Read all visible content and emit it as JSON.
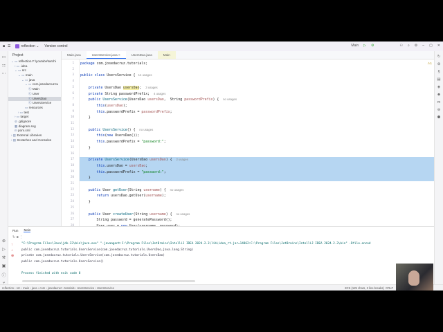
{
  "titlebar": {
    "project": "reflection",
    "vcs": "Version control",
    "run_config": "Main",
    "window_controls": [
      "–",
      "▢",
      "✕"
    ]
  },
  "project_panel": {
    "title": "Project",
    "tree": [
      {
        "label": "reflection  F:\\youtube\\tarchi",
        "d": 0,
        "ic": "⌄ ▭"
      },
      {
        "label": ".idea",
        "d": 1,
        "ic": "› ▭"
      },
      {
        "label": "src",
        "d": 1,
        "ic": "⌄ ▭"
      },
      {
        "label": "main",
        "d": 2,
        "ic": "⌄ ▭"
      },
      {
        "label": "java",
        "d": 3,
        "ic": "⌄ ▭"
      },
      {
        "label": "com.josedacruz.tu",
        "d": 4,
        "ic": "⌄ ▭"
      },
      {
        "label": "Main",
        "d": 5,
        "ic": "Ⓒ"
      },
      {
        "label": "User",
        "d": 5,
        "ic": "Ⓒ"
      },
      {
        "label": "UsersDao",
        "d": 5,
        "ic": "Ⓒ",
        "sel": true
      },
      {
        "label": "UsersService",
        "d": 5,
        "ic": "Ⓒ"
      },
      {
        "label": "resources",
        "d": 4,
        "ic": "▭"
      },
      {
        "label": "test",
        "d": 2,
        "ic": "› ▭"
      },
      {
        "label": "target",
        "d": 1,
        "ic": "› ▭"
      },
      {
        "label": ".gitignore",
        "d": 1,
        "ic": "⊘"
      },
      {
        "label": "diagram.svg",
        "d": 1,
        "ic": "▦"
      },
      {
        "label": "pom.xml",
        "d": 1,
        "ic": "m"
      },
      {
        "label": "External Libraries",
        "d": 0,
        "ic": "› ▥"
      },
      {
        "label": "Scratches and Consoles",
        "d": 0,
        "ic": "› ▤"
      }
    ]
  },
  "tabs": [
    {
      "label": "Main.java"
    },
    {
      "label": "UsersService.java ×",
      "active": true
    },
    {
      "label": "UsersDao.java"
    },
    {
      "label": "Main",
      "main": true
    }
  ],
  "editor": {
    "warnings": "⚠1",
    "lines": [
      [
        [
          "kw",
          "package "
        ],
        [
          "def",
          "com.josedacruz.tutorials;"
        ]
      ],
      [],
      [
        [
          "kw",
          "public class "
        ],
        [
          "def",
          "UsersService { "
        ],
        [
          "hint",
          " 14 usages"
        ]
      ],
      [],
      [
        [
          "kw",
          "    private "
        ],
        [
          "def",
          "UsersDao "
        ],
        [
          "occ",
          "usersDao"
        ],
        [
          "def",
          ";  "
        ],
        [
          "hint",
          "3 usages"
        ]
      ],
      [
        [
          "kw",
          "    private "
        ],
        [
          "def",
          "String passwordPrefix;  "
        ],
        [
          "hint",
          "4 usages"
        ]
      ],
      [
        [
          "kw",
          "    public "
        ],
        [
          "fn",
          "UsersService"
        ],
        [
          "def",
          "(UsersDao "
        ],
        [
          "par",
          "usersDao"
        ],
        [
          "def",
          ",  String "
        ],
        [
          "par",
          "passwordPrefix"
        ],
        [
          "def",
          ") {  "
        ],
        [
          "hint",
          "no usages"
        ]
      ],
      [
        [
          "kw",
          "        this"
        ],
        [
          "def",
          "("
        ],
        [
          "par",
          "usersDao"
        ],
        [
          "def",
          ");"
        ]
      ],
      [
        [
          "kw",
          "        this"
        ],
        [
          "def",
          ".passwordPrefix = "
        ],
        [
          "par",
          "passwordPrefix"
        ],
        [
          "def",
          ";"
        ]
      ],
      [
        [
          "def",
          "    }"
        ]
      ],
      [],
      [
        [
          "kw",
          "    public "
        ],
        [
          "fn",
          "UsersService"
        ],
        [
          "def",
          "() {  "
        ],
        [
          "hint",
          "no usages"
        ]
      ],
      [
        [
          "kw",
          "        this"
        ],
        [
          "def",
          "("
        ],
        [
          "kw",
          "new "
        ],
        [
          "def",
          "UsersDao());"
        ]
      ],
      [
        [
          "kw",
          "        this"
        ],
        [
          "def",
          ".passwordPrefix = "
        ],
        [
          "str",
          "\"password:\""
        ],
        [
          "def",
          ";"
        ]
      ],
      [
        [
          "def",
          "    }"
        ]
      ],
      [],
      [
        [
          "kw",
          "    private "
        ],
        [
          "fn",
          "UsersService"
        ],
        [
          "def",
          "(UsersDao "
        ],
        [
          "par",
          "usersDao"
        ],
        [
          "def",
          ") {  "
        ],
        [
          "hint",
          "2 usages"
        ]
      ],
      [
        [
          "kw",
          "        this"
        ],
        [
          "def",
          ".usersDao = "
        ],
        [
          "par",
          "usersDao"
        ],
        [
          "def",
          ";"
        ]
      ],
      [
        [
          "kw",
          "        this"
        ],
        [
          "def",
          ".passwordPrefix = "
        ],
        [
          "str",
          "\"password:\""
        ],
        [
          "def",
          ";"
        ]
      ],
      [
        [
          "def",
          "    }"
        ]
      ],
      [],
      [
        [
          "kw",
          "    public "
        ],
        [
          "def",
          "User "
        ],
        [
          "fn",
          "getUser"
        ],
        [
          "def",
          "(String "
        ],
        [
          "par",
          "username"
        ],
        [
          "def",
          ") {  "
        ],
        [
          "hint",
          "no usages"
        ]
      ],
      [
        [
          "kw",
          "        return "
        ],
        [
          "def",
          "usersDao.getUser("
        ],
        [
          "par",
          "username"
        ],
        [
          "def",
          ");"
        ]
      ],
      [
        [
          "def",
          "    }"
        ]
      ],
      [],
      [
        [
          "kw",
          "    public "
        ],
        [
          "def",
          "User "
        ],
        [
          "fn",
          "createUser"
        ],
        [
          "def",
          "(String "
        ],
        [
          "par",
          "username"
        ],
        [
          "def",
          ") {  "
        ],
        [
          "hint",
          "no usages"
        ]
      ],
      [
        [
          "def",
          "        String password = generatePassword();"
        ]
      ],
      [
        [
          "def",
          "        User user = "
        ],
        [
          "kw",
          "new "
        ],
        [
          "def",
          "User(username, password);"
        ]
      ]
    ],
    "highlighted": [
      17,
      18,
      19,
      20
    ]
  },
  "run": {
    "title": "Run",
    "tab": "Main",
    "output": [
      "\"C:\\Program Files\\Java\\jdk-23\\bin\\java.exe\" \"-javaagent:C:\\Program Files\\JetBrains\\IntelliJ IDEA 2024.2.3\\lib\\idea_rt.jar=14862:C:\\Program Files\\JetBrains\\IntelliJ IDEA 2024.2.3\\bin\" -Dfile.encod",
      "public com.josedacruz.tutorials.UsersService(com.josedacruz.tutorials.UsersDao,java.lang.String)",
      "private com.josedacruz.tutorials.UsersService(com.josedacruz.tutorials.UsersDao)",
      "public com.josedacruz.tutorials.UsersService()",
      "",
      "Process finished with exit code 0"
    ]
  },
  "status": {
    "breadcrumb": [
      "reflection",
      "src",
      "main",
      "java",
      "com",
      "josedacruz",
      "tutorials",
      "UsersService",
      "UsersService"
    ],
    "position": "20:6 (125 chars, 3 line breaks)",
    "line_sep": "CRLF"
  }
}
